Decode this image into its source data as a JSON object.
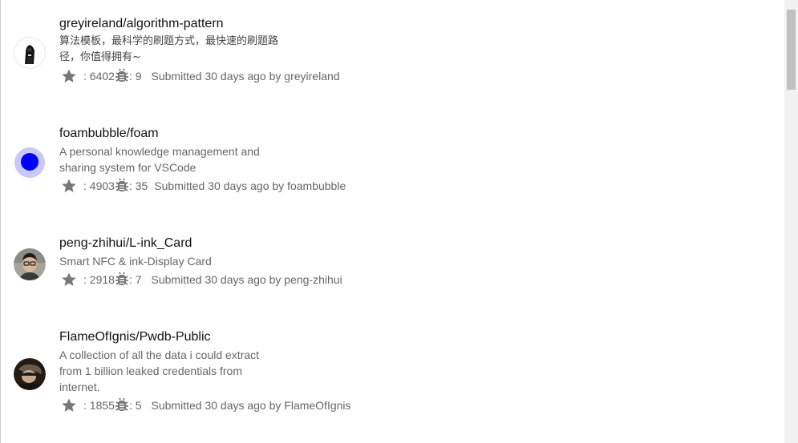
{
  "repos": [
    {
      "name": "greyireland/algorithm-pattern",
      "description": "算法模板，最科学的刷题方式，最快速的刷题路径，你值得拥有~",
      "stars": ": 6402",
      "issues": ": 9",
      "submitted": "Submitted 30 days ago by greyireland",
      "avatar_icon": "hooded-figure-avatar"
    },
    {
      "name": "foambubble/foam",
      "description": "A personal knowledge management and sharing system for VSCode",
      "stars": ": 4903",
      "issues": ": 35",
      "submitted": "Submitted 30 days ago by foambubble",
      "avatar_icon": "blue-bubble-avatar"
    },
    {
      "name": "peng-zhihui/L-ink_Card",
      "description": "Smart NFC & ink-Display Card",
      "stars": ": 2918",
      "issues": ": 7",
      "submitted": "Submitted 30 days ago by peng-zhihui",
      "avatar_icon": "person-photo-avatar"
    },
    {
      "name": "FlameOfIgnis/Pwdb-Public",
      "description": "A collection of all the data i could extract from 1 billion leaked credentials from internet.",
      "stars": ": 1855",
      "issues": ": 5",
      "submitted": "Submitted 30 days ago by FlameOfIgnis",
      "avatar_icon": "person-photo-avatar"
    }
  ],
  "icons": {
    "star": "star-icon",
    "issue": "bug-icon"
  },
  "colors": {
    "text_primary": "#111111",
    "text_secondary": "#666666",
    "icon_gray": "#777777",
    "foam_blue": "#0000ff",
    "foam_ring": "#c8c8ff"
  }
}
